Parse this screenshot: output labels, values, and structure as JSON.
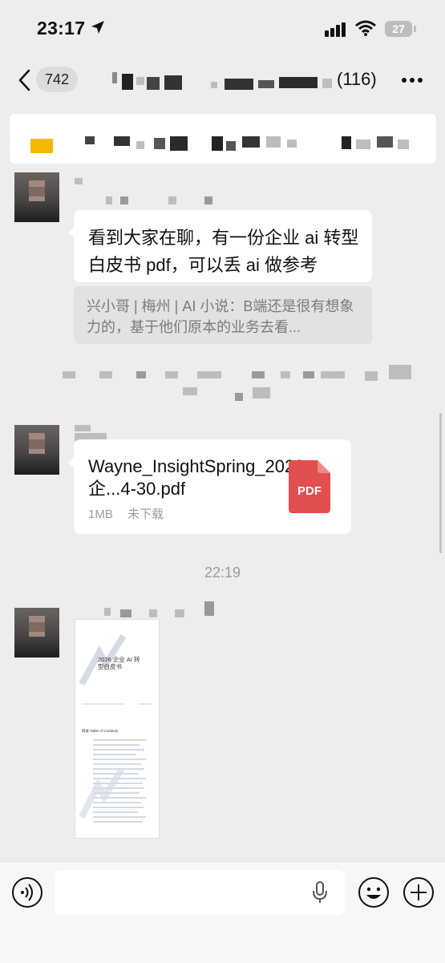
{
  "status_bar": {
    "time": "23:17",
    "battery": "27"
  },
  "nav": {
    "back_count": "742",
    "chat_title": "(116)"
  },
  "messages": [
    {
      "text": "看到大家在聊，有一份企业 ai 转型白皮书 pdf，可以丢 ai 做参考",
      "quote": "兴小哥 | 梅州 | AI 小说：B端还是很有想象力的，基于他们原本的业务去看..."
    },
    {
      "file_name": "Wayne_InsightSpring_2026企...4-30.pdf",
      "file_size": "1MB",
      "file_status": "未下载",
      "file_badge": "PDF"
    }
  ],
  "timestamp": "22:19",
  "doc_preview": {
    "title": "2026 企业 AI 转型白皮书",
    "toc_label": "目录  Table of Contents"
  },
  "colors": {
    "background": "#ededed",
    "bubble": "#ffffff",
    "pdf_red": "#e24f4f",
    "pin_yellow": "#f5b800"
  }
}
